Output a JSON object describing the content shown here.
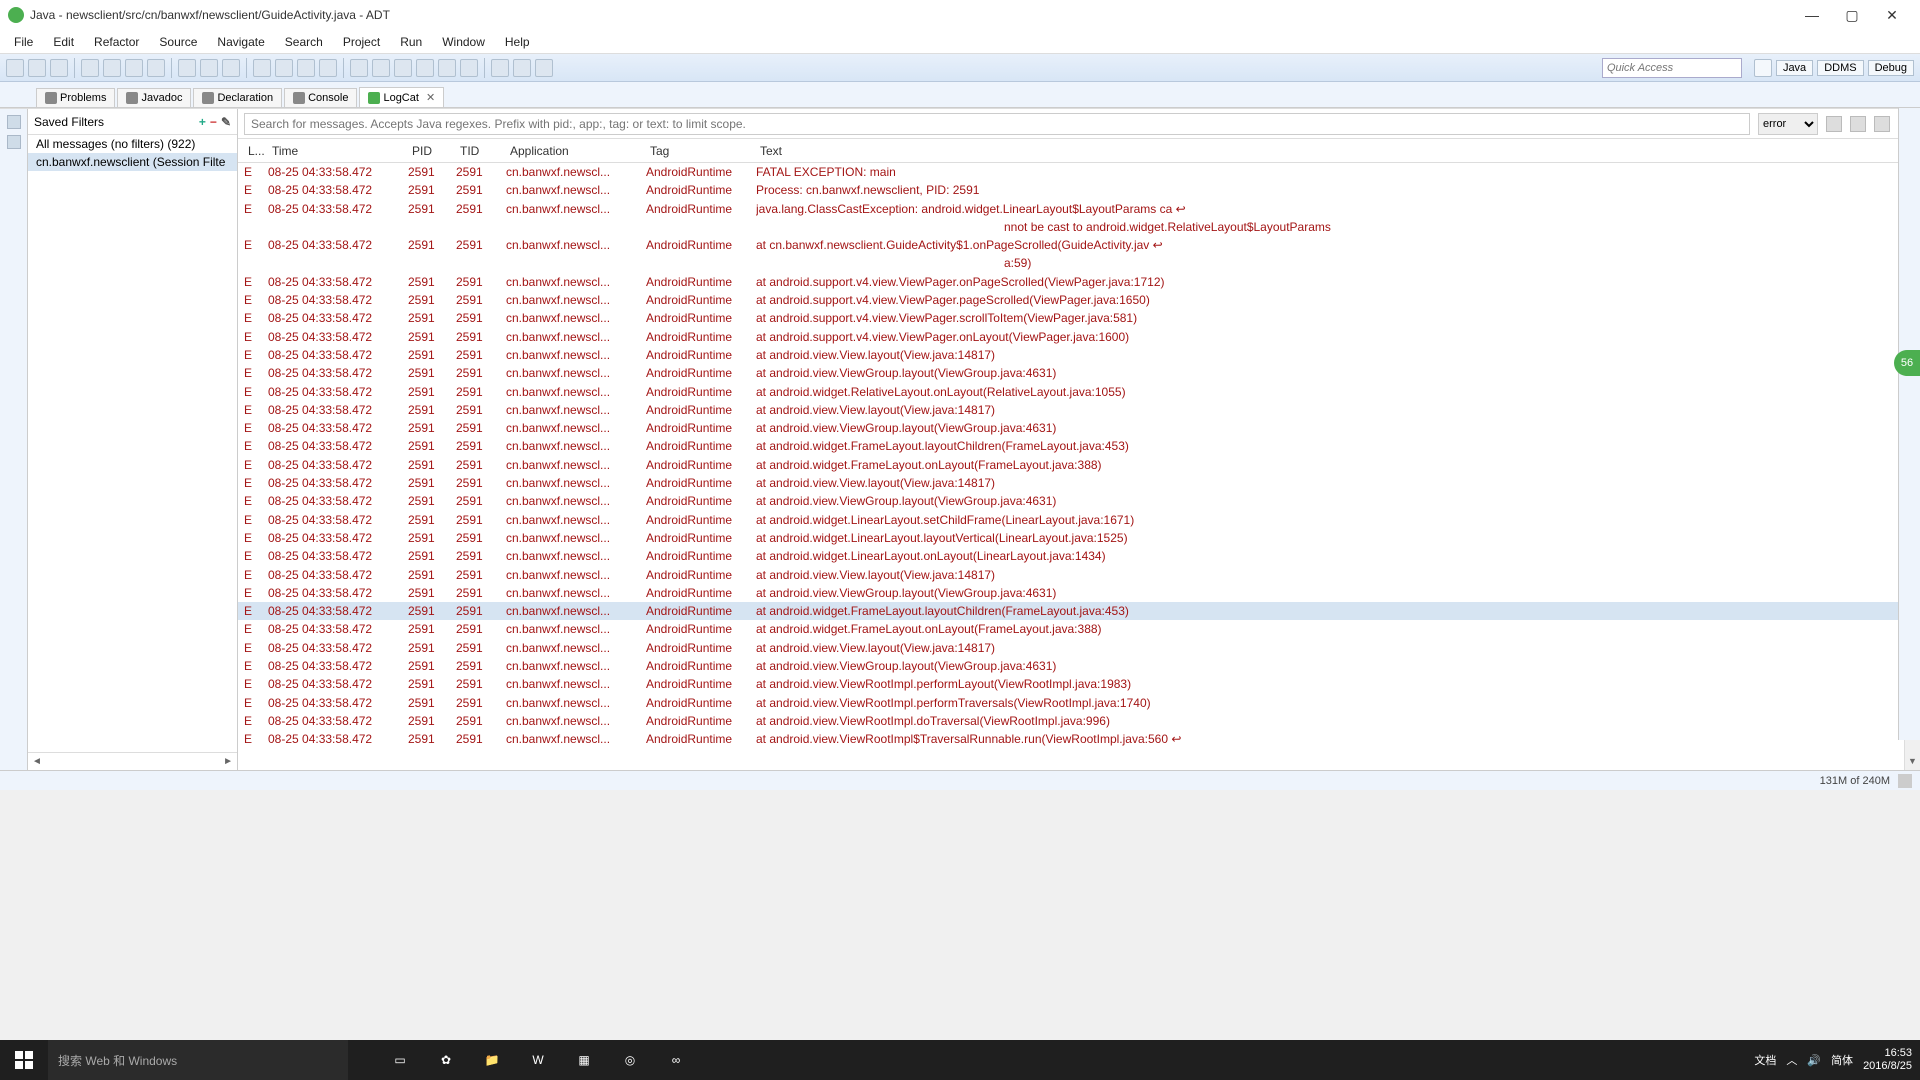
{
  "title": "Java - newsclient/src/cn/banwxf/newsclient/GuideActivity.java - ADT",
  "menu": [
    "File",
    "Edit",
    "Refactor",
    "Source",
    "Navigate",
    "Search",
    "Project",
    "Run",
    "Window",
    "Help"
  ],
  "quick_access_placeholder": "Quick Access",
  "perspectives": [
    "Java",
    "DDMS",
    "Debug"
  ],
  "tabs": [
    {
      "label": "Problems"
    },
    {
      "label": "Javadoc"
    },
    {
      "label": "Declaration"
    },
    {
      "label": "Console"
    },
    {
      "label": "LogCat",
      "active": true
    }
  ],
  "saved_filters": {
    "title": "Saved Filters",
    "items": [
      "All messages (no filters) (922)",
      "cn.banwxf.newsclient (Session Filte"
    ],
    "selected": 1
  },
  "search_placeholder": "Search for messages. Accepts Java regexes. Prefix with pid:, app:, tag: or text: to limit scope.",
  "filter_level": "error",
  "columns": {
    "l": "L...",
    "time": "Time",
    "pid": "PID",
    "tid": "TID",
    "app": "Application",
    "tag": "Tag",
    "text": "Text"
  },
  "selected_row": 24,
  "rows": [
    {
      "l": "E",
      "time": "08-25 04:33:58.472",
      "pid": "2591",
      "tid": "2591",
      "app": "cn.banwxf.newscl...",
      "tag": "AndroidRuntime",
      "text": "FATAL EXCEPTION: main"
    },
    {
      "l": "E",
      "time": "08-25 04:33:58.472",
      "pid": "2591",
      "tid": "2591",
      "app": "cn.banwxf.newscl...",
      "tag": "AndroidRuntime",
      "text": "Process: cn.banwxf.newsclient, PID: 2591"
    },
    {
      "l": "E",
      "time": "08-25 04:33:58.472",
      "pid": "2591",
      "tid": "2591",
      "app": "cn.banwxf.newscl...",
      "tag": "AndroidRuntime",
      "text": "java.lang.ClassCastException: android.widget.LinearLayout$LayoutParams ca ↩"
    },
    {
      "wrap": true,
      "text": "nnot be cast to android.widget.RelativeLayout$LayoutParams"
    },
    {
      "l": "E",
      "time": "08-25 04:33:58.472",
      "pid": "2591",
      "tid": "2591",
      "app": "cn.banwxf.newscl...",
      "tag": "AndroidRuntime",
      "text": "at cn.banwxf.newsclient.GuideActivity$1.onPageScrolled(GuideActivity.jav ↩"
    },
    {
      "wrap": true,
      "text": "a:59)"
    },
    {
      "l": "E",
      "time": "08-25 04:33:58.472",
      "pid": "2591",
      "tid": "2591",
      "app": "cn.banwxf.newscl...",
      "tag": "AndroidRuntime",
      "text": "at android.support.v4.view.ViewPager.onPageScrolled(ViewPager.java:1712)"
    },
    {
      "l": "E",
      "time": "08-25 04:33:58.472",
      "pid": "2591",
      "tid": "2591",
      "app": "cn.banwxf.newscl...",
      "tag": "AndroidRuntime",
      "text": "at android.support.v4.view.ViewPager.pageScrolled(ViewPager.java:1650)"
    },
    {
      "l": "E",
      "time": "08-25 04:33:58.472",
      "pid": "2591",
      "tid": "2591",
      "app": "cn.banwxf.newscl...",
      "tag": "AndroidRuntime",
      "text": "at android.support.v4.view.ViewPager.scrollToItem(ViewPager.java:581)"
    },
    {
      "l": "E",
      "time": "08-25 04:33:58.472",
      "pid": "2591",
      "tid": "2591",
      "app": "cn.banwxf.newscl...",
      "tag": "AndroidRuntime",
      "text": "at android.support.v4.view.ViewPager.onLayout(ViewPager.java:1600)"
    },
    {
      "l": "E",
      "time": "08-25 04:33:58.472",
      "pid": "2591",
      "tid": "2591",
      "app": "cn.banwxf.newscl...",
      "tag": "AndroidRuntime",
      "text": "at android.view.View.layout(View.java:14817)"
    },
    {
      "l": "E",
      "time": "08-25 04:33:58.472",
      "pid": "2591",
      "tid": "2591",
      "app": "cn.banwxf.newscl...",
      "tag": "AndroidRuntime",
      "text": "at android.view.ViewGroup.layout(ViewGroup.java:4631)"
    },
    {
      "l": "E",
      "time": "08-25 04:33:58.472",
      "pid": "2591",
      "tid": "2591",
      "app": "cn.banwxf.newscl...",
      "tag": "AndroidRuntime",
      "text": "at android.widget.RelativeLayout.onLayout(RelativeLayout.java:1055)"
    },
    {
      "l": "E",
      "time": "08-25 04:33:58.472",
      "pid": "2591",
      "tid": "2591",
      "app": "cn.banwxf.newscl...",
      "tag": "AndroidRuntime",
      "text": "at android.view.View.layout(View.java:14817)"
    },
    {
      "l": "E",
      "time": "08-25 04:33:58.472",
      "pid": "2591",
      "tid": "2591",
      "app": "cn.banwxf.newscl...",
      "tag": "AndroidRuntime",
      "text": "at android.view.ViewGroup.layout(ViewGroup.java:4631)"
    },
    {
      "l": "E",
      "time": "08-25 04:33:58.472",
      "pid": "2591",
      "tid": "2591",
      "app": "cn.banwxf.newscl...",
      "tag": "AndroidRuntime",
      "text": "at android.widget.FrameLayout.layoutChildren(FrameLayout.java:453)"
    },
    {
      "l": "E",
      "time": "08-25 04:33:58.472",
      "pid": "2591",
      "tid": "2591",
      "app": "cn.banwxf.newscl...",
      "tag": "AndroidRuntime",
      "text": "at android.widget.FrameLayout.onLayout(FrameLayout.java:388)"
    },
    {
      "l": "E",
      "time": "08-25 04:33:58.472",
      "pid": "2591",
      "tid": "2591",
      "app": "cn.banwxf.newscl...",
      "tag": "AndroidRuntime",
      "text": "at android.view.View.layout(View.java:14817)"
    },
    {
      "l": "E",
      "time": "08-25 04:33:58.472",
      "pid": "2591",
      "tid": "2591",
      "app": "cn.banwxf.newscl...",
      "tag": "AndroidRuntime",
      "text": "at android.view.ViewGroup.layout(ViewGroup.java:4631)"
    },
    {
      "l": "E",
      "time": "08-25 04:33:58.472",
      "pid": "2591",
      "tid": "2591",
      "app": "cn.banwxf.newscl...",
      "tag": "AndroidRuntime",
      "text": "at android.widget.LinearLayout.setChildFrame(LinearLayout.java:1671)"
    },
    {
      "l": "E",
      "time": "08-25 04:33:58.472",
      "pid": "2591",
      "tid": "2591",
      "app": "cn.banwxf.newscl...",
      "tag": "AndroidRuntime",
      "text": "at android.widget.LinearLayout.layoutVertical(LinearLayout.java:1525)"
    },
    {
      "l": "E",
      "time": "08-25 04:33:58.472",
      "pid": "2591",
      "tid": "2591",
      "app": "cn.banwxf.newscl...",
      "tag": "AndroidRuntime",
      "text": "at android.widget.LinearLayout.onLayout(LinearLayout.java:1434)"
    },
    {
      "l": "E",
      "time": "08-25 04:33:58.472",
      "pid": "2591",
      "tid": "2591",
      "app": "cn.banwxf.newscl...",
      "tag": "AndroidRuntime",
      "text": "at android.view.View.layout(View.java:14817)"
    },
    {
      "l": "E",
      "time": "08-25 04:33:58.472",
      "pid": "2591",
      "tid": "2591",
      "app": "cn.banwxf.newscl...",
      "tag": "AndroidRuntime",
      "text": "at android.view.ViewGroup.layout(ViewGroup.java:4631)"
    },
    {
      "l": "E",
      "time": "08-25 04:33:58.472",
      "pid": "2591",
      "tid": "2591",
      "app": "cn.banwxf.newscl...",
      "tag": "AndroidRuntime",
      "text": "at android.widget.FrameLayout.layoutChildren(FrameLayout.java:453)"
    },
    {
      "l": "E",
      "time": "08-25 04:33:58.472",
      "pid": "2591",
      "tid": "2591",
      "app": "cn.banwxf.newscl...",
      "tag": "AndroidRuntime",
      "text": "at android.widget.FrameLayout.onLayout(FrameLayout.java:388)"
    },
    {
      "l": "E",
      "time": "08-25 04:33:58.472",
      "pid": "2591",
      "tid": "2591",
      "app": "cn.banwxf.newscl...",
      "tag": "AndroidRuntime",
      "text": "at android.view.View.layout(View.java:14817)"
    },
    {
      "l": "E",
      "time": "08-25 04:33:58.472",
      "pid": "2591",
      "tid": "2591",
      "app": "cn.banwxf.newscl...",
      "tag": "AndroidRuntime",
      "text": "at android.view.ViewGroup.layout(ViewGroup.java:4631)"
    },
    {
      "l": "E",
      "time": "08-25 04:33:58.472",
      "pid": "2591",
      "tid": "2591",
      "app": "cn.banwxf.newscl...",
      "tag": "AndroidRuntime",
      "text": "at android.view.ViewRootImpl.performLayout(ViewRootImpl.java:1983)"
    },
    {
      "l": "E",
      "time": "08-25 04:33:58.472",
      "pid": "2591",
      "tid": "2591",
      "app": "cn.banwxf.newscl...",
      "tag": "AndroidRuntime",
      "text": "at android.view.ViewRootImpl.performTraversals(ViewRootImpl.java:1740)"
    },
    {
      "l": "E",
      "time": "08-25 04:33:58.472",
      "pid": "2591",
      "tid": "2591",
      "app": "cn.banwxf.newscl...",
      "tag": "AndroidRuntime",
      "text": "at android.view.ViewRootImpl.doTraversal(ViewRootImpl.java:996)"
    },
    {
      "l": "E",
      "time": "08-25 04:33:58.472",
      "pid": "2591",
      "tid": "2591",
      "app": "cn.banwxf.newscl...",
      "tag": "AndroidRuntime",
      "text": "at android.view.ViewRootImpl$TraversalRunnable.run(ViewRootImpl.java:560 ↩"
    }
  ],
  "memory": "131M of 240M",
  "taskbar": {
    "search": "搜索 Web 和 Windows",
    "doc": "文档",
    "ime": "简体",
    "time": "16:53",
    "date": "2016/8/25"
  },
  "float": "56"
}
